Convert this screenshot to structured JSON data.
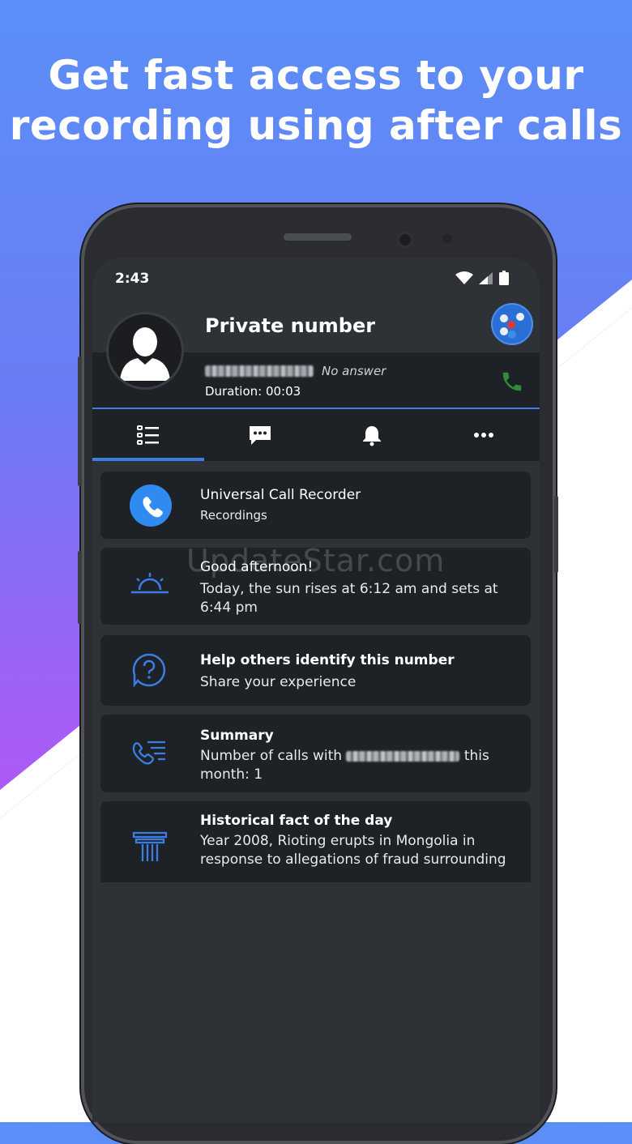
{
  "promo": {
    "headline_line1": "Get fast access to your",
    "headline_line2": "recording using after calls"
  },
  "status_bar": {
    "time": "2:43",
    "icons": [
      "wifi-icon",
      "signal-icon",
      "battery-icon"
    ]
  },
  "caller": {
    "name": "Private number",
    "status": "No answer",
    "duration": "Duration: 00:03",
    "avatar_icon": "person-icon",
    "call_icon": "phone-icon"
  },
  "tabs": [
    {
      "name": "list",
      "icon": "list-icon",
      "selected": true
    },
    {
      "name": "message",
      "icon": "message-icon",
      "selected": false
    },
    {
      "name": "reminder",
      "icon": "bell-icon",
      "selected": false
    },
    {
      "name": "more",
      "icon": "more-icon",
      "selected": false
    }
  ],
  "watermark": "UpdateStar.com",
  "cards": [
    {
      "icon": "phone-circle-icon",
      "title": "Universal Call Recorder",
      "text": "Recordings"
    },
    {
      "icon": "sunrise-icon",
      "title": "Good afternoon!",
      "text": "Today, the sun rises at 6:12 am and sets at 6:44 pm"
    },
    {
      "icon": "question-bubble-icon",
      "title": "Help others identify this number",
      "text": "Share your experience"
    },
    {
      "icon": "call-log-icon",
      "title": "Summary",
      "text_prefix": "Number of calls with",
      "text_suffix": "this",
      "text_line2": "month: 1"
    },
    {
      "icon": "museum-icon",
      "title": "Historical fact of the day",
      "text": "Year 2008, Rioting erupts in Mongolia in response to allegations of fraud surrounding"
    }
  ],
  "colors": {
    "accent": "#3a7de3",
    "call_green": "#2e8b3a",
    "card_bg": "#1e2125",
    "screen_bg": "#2e3237"
  }
}
